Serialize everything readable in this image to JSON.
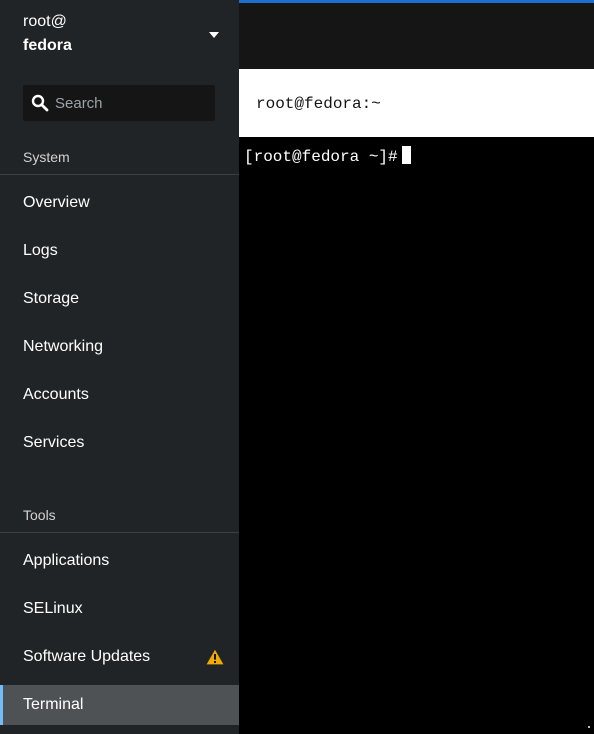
{
  "host": {
    "user": "root@",
    "name": "fedora"
  },
  "search": {
    "placeholder": "Search"
  },
  "sections": {
    "system": "System",
    "tools": "Tools"
  },
  "nav": {
    "system_items": [
      {
        "label": "Overview"
      },
      {
        "label": "Logs"
      },
      {
        "label": "Storage"
      },
      {
        "label": "Networking"
      },
      {
        "label": "Accounts"
      },
      {
        "label": "Services"
      }
    ],
    "tools_items": [
      {
        "label": "Applications"
      },
      {
        "label": "SELinux"
      },
      {
        "label": "Software Updates",
        "badge_icon": "warning-icon"
      },
      {
        "label": "Terminal",
        "active": true
      }
    ]
  },
  "terminal": {
    "title": "root@fedora:~",
    "prompt": "[root@fedora ~]#"
  },
  "colors": {
    "sidebar_bg": "#212427",
    "active_item_bg": "#4f5255",
    "active_accent": "#73bcf7",
    "topbar_accent": "#1f6fd1",
    "warning": "#f0ab00"
  }
}
